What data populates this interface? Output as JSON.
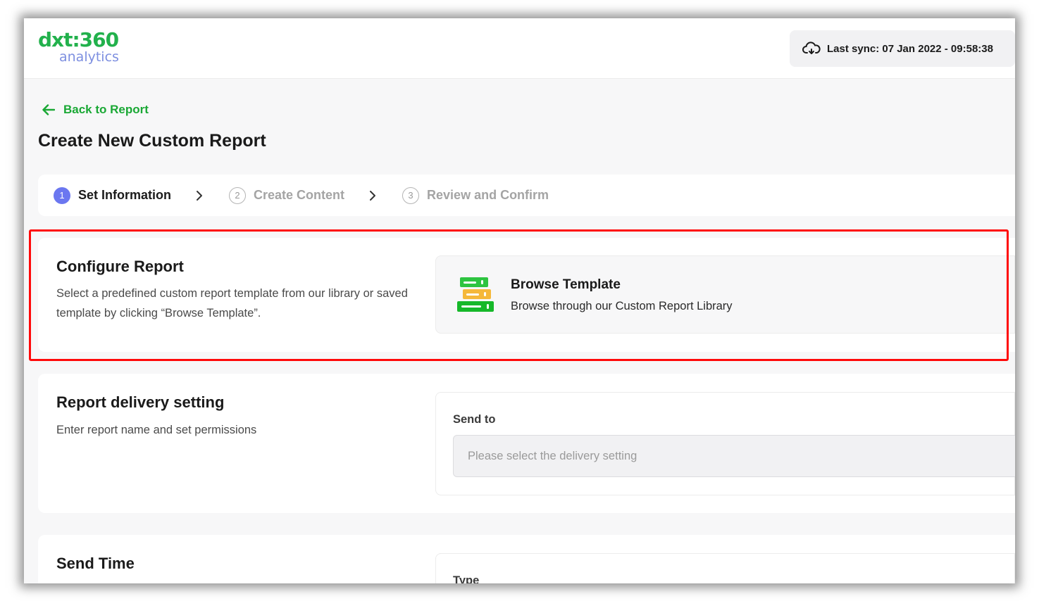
{
  "app": {
    "logo_top": "dxt:360",
    "logo_bottom": "analytics"
  },
  "header": {
    "sync_text": "Last sync: 07 Jan 2022 - 09:58:38",
    "sync_icon": "cloud-sync-icon"
  },
  "nav": {
    "back_label": "Back to Report",
    "back_icon": "arrow-left-icon"
  },
  "page": {
    "title": "Create New Custom Report"
  },
  "stepper": {
    "steps": [
      {
        "number": "1",
        "label": "Set Information",
        "state": "active"
      },
      {
        "number": "2",
        "label": "Create Content",
        "state": "inactive"
      },
      {
        "number": "3",
        "label": "Review and Confirm",
        "state": "inactive"
      }
    ]
  },
  "configure": {
    "title": "Configure Report",
    "description": "Select a predefined custom report template from our library or saved template by clicking “Browse Template”.",
    "browse_title": "Browse Template",
    "browse_subtitle": "Browse through our Custom Report Library",
    "browse_icon": "template-stack-icon"
  },
  "delivery": {
    "title": "Report delivery setting",
    "description": "Enter report name and set permissions",
    "field_label": "Send to",
    "placeholder": "Please select the delivery setting"
  },
  "send_time": {
    "title": "Send Time",
    "field_label": "Type"
  },
  "colors": {
    "brand_green": "#1aa835",
    "accent_blue": "#6b77f0",
    "highlight_red": "#ff0a0a"
  }
}
